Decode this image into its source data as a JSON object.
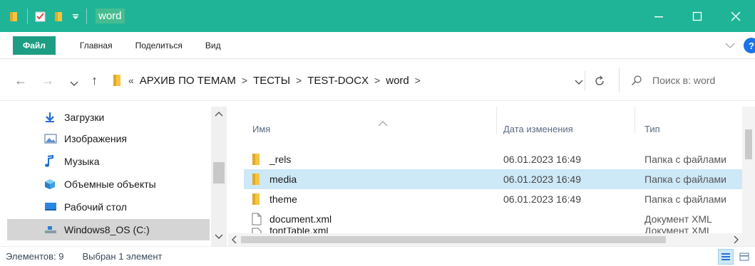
{
  "window": {
    "title": "word",
    "accent_color": "#1fb497"
  },
  "ribbon": {
    "tabs": [
      {
        "label": "Файл",
        "active": true
      },
      {
        "label": "Главная"
      },
      {
        "label": "Поделиться"
      },
      {
        "label": "Вид"
      }
    ]
  },
  "address": {
    "prefix": "«",
    "crumbs": [
      "АРХИВ ПО ТЕМАМ",
      "ТЕСТЫ",
      "TEST-DOCX",
      "word"
    ],
    "search_placeholder": "Поиск в: word"
  },
  "nav_pane": {
    "items": [
      {
        "label": "Загрузки",
        "icon": "download-arrow-icon"
      },
      {
        "label": "Изображения",
        "icon": "pictures-icon"
      },
      {
        "label": "Музыка",
        "icon": "music-note-icon"
      },
      {
        "label": "Объемные объекты",
        "icon": "3d-cube-icon"
      },
      {
        "label": "Рабочий стол",
        "icon": "desktop-icon"
      },
      {
        "label": "Windows8_OS (C:)",
        "icon": "drive-icon",
        "selected": true
      }
    ]
  },
  "file_list": {
    "columns": {
      "name": "Имя",
      "date": "Дата изменения",
      "type": "Тип"
    },
    "rows": [
      {
        "name": "_rels",
        "date": "06.01.2023 16:49",
        "type": "Папка с файлами",
        "kind": "folder"
      },
      {
        "name": "media",
        "date": "06.01.2023 16:49",
        "type": "Папка с файлами",
        "kind": "folder",
        "selected": true
      },
      {
        "name": "theme",
        "date": "06.01.2023 16:49",
        "type": "Папка с файлами",
        "kind": "folder"
      },
      {
        "name": "document.xml",
        "date": "",
        "type": "Документ XML",
        "kind": "file"
      },
      {
        "name": "fontTable.xml",
        "date": "",
        "type": "Документ XML",
        "kind": "file"
      }
    ]
  },
  "status": {
    "count": "Элементов: 9",
    "selection": "Выбран 1 элемент"
  }
}
